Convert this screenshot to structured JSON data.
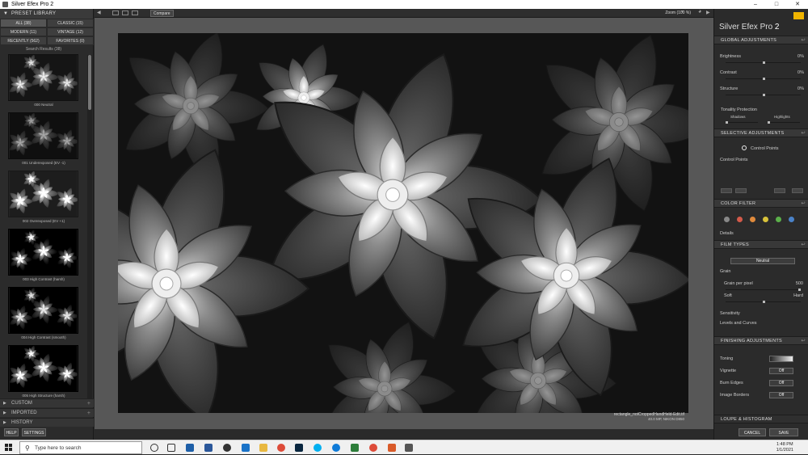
{
  "window": {
    "title": "Silver Efex Pro 2"
  },
  "preset_library": {
    "title": "PRESET LIBRARY",
    "categories": [
      {
        "label": "ALL (38)",
        "active": true
      },
      {
        "label": "CLASSIC (15)",
        "active": false
      },
      {
        "label": "MODERN (11)",
        "active": false
      },
      {
        "label": "VINTAGE (12)",
        "active": false
      },
      {
        "label": "RECENTLY (562)",
        "active": false
      },
      {
        "label": "FAVORITES (0)",
        "active": false
      }
    ],
    "search_results": "Search Results (38)",
    "presets": [
      {
        "label": "000 Neutral"
      },
      {
        "label": "001 Underexposed (EV -1)"
      },
      {
        "label": "002 Overexposed (EV +1)"
      },
      {
        "label": "003 High Contrast (harsh)"
      },
      {
        "label": "004 High Contrast (smooth)"
      },
      {
        "label": "005 High Structure (harsh)"
      }
    ],
    "collections": [
      {
        "label": "CUSTOM"
      },
      {
        "label": "IMPORTED"
      },
      {
        "label": "HISTORY"
      }
    ]
  },
  "left_buttons": {
    "help": "HELP",
    "settings": "SETTINGS"
  },
  "toolbar": {
    "compare": "Compare",
    "zoom": "Zoom (100 %)"
  },
  "image": {
    "filename": "rectangle_notCroppedHandHeld-Edit.tif",
    "meta": "40.0 MP, NIKON D850"
  },
  "right_panel": {
    "brand": "Silver Efex Pro",
    "version": "2",
    "global_title": "GLOBAL ADJUSTMENTS",
    "global_rows": [
      {
        "label": "Brightness",
        "value": "0%"
      },
      {
        "label": "Contrast",
        "value": "0%"
      },
      {
        "label": "Structure",
        "value": "0%"
      }
    ],
    "tonality": {
      "label": "Tonality Protection",
      "shadows": "Shadows",
      "highlights": "Highlights"
    },
    "selective_title": "SELECTIVE ADJUSTMENTS",
    "control_points_btn": "Control Points",
    "control_points_label": "Control Points",
    "color_filter_title": "COLOR FILTER",
    "color_filter_dots": [
      "#888888",
      "#d45a4a",
      "#e08a3c",
      "#d8c23a",
      "#5bb04a",
      "#4a82c8"
    ],
    "details": "Details",
    "film_types_title": "FILM TYPES",
    "film_select": "Neutral",
    "grain_label": "Grain",
    "grain_per_pixel": "Grain per pixel",
    "grain_value": "500",
    "soft": "Soft",
    "hard": "Hard",
    "sensitivity": "Sensitivity",
    "levels_curves": "Levels and Curves",
    "finishing_title": "FINISHING ADJUSTMENTS",
    "finishing_rows": [
      {
        "label": "Toning",
        "control": ""
      },
      {
        "label": "Vignette",
        "control": "Off"
      },
      {
        "label": "Burn Edges",
        "control": "Off"
      },
      {
        "label": "Image Borders",
        "control": "Off"
      }
    ],
    "loupe_title": "LOUPE & HISTOGRAM",
    "cancel": "CANCEL",
    "save": "SAVE"
  },
  "taskbar": {
    "search_placeholder": "Type here to search",
    "time": "1:48 PM",
    "date": "1/1/2021",
    "icons": [
      "task-view-icon",
      "photos-icon",
      "word-icon",
      "media-icon",
      "file-explorer-icon",
      "chrome-icon",
      "lightroom-icon",
      "skype-icon",
      "edge-icon",
      "store-icon",
      "photoshop-icon",
      "chrome-icon",
      "paint-icon",
      "app-icon"
    ]
  }
}
